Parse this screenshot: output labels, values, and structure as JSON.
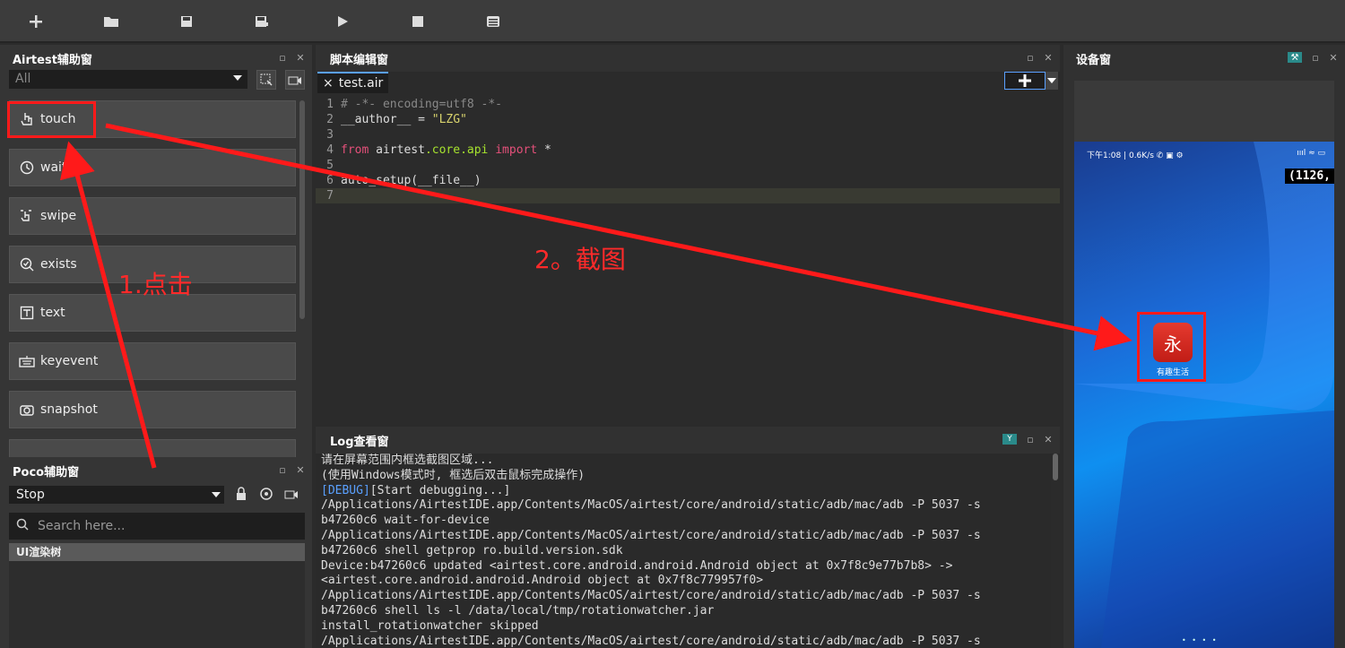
{
  "toolbar": {
    "buttons": [
      "new-icon",
      "open-folder-icon",
      "save-icon",
      "save-as-icon",
      "run-icon",
      "stop-icon",
      "log-icon"
    ]
  },
  "left_panel": {
    "title": "Airtest辅助窗",
    "filter_value": "All",
    "items": [
      {
        "label": "touch",
        "icon": "touch-icon"
      },
      {
        "label": "wait",
        "icon": "clock-icon"
      },
      {
        "label": "swipe",
        "icon": "swipe-icon"
      },
      {
        "label": "exists",
        "icon": "check-icon"
      },
      {
        "label": "text",
        "icon": "text-icon"
      },
      {
        "label": "keyevent",
        "icon": "keyboard-icon"
      },
      {
        "label": "snapshot",
        "icon": "camera-icon"
      }
    ]
  },
  "poco_panel": {
    "title": "Poco辅助窗",
    "mode_value": "Stop",
    "search_placeholder": "Search here...",
    "tree_title": "UI渲染树"
  },
  "editor": {
    "title": "脚本编辑窗",
    "tab_label": "test.air",
    "lines": [
      {
        "n": "1",
        "text": "# -*- encoding=utf8 -*-"
      },
      {
        "n": "2",
        "a": "__author__ = ",
        "b": "\"LZG\""
      },
      {
        "n": "3",
        "text": ""
      },
      {
        "n": "4",
        "a": "from",
        "b": " airtest",
        "c": ".core.api ",
        "d": "import",
        "e": " *"
      },
      {
        "n": "5",
        "text": ""
      },
      {
        "n": "6",
        "text": "auto_setup(__file__)"
      },
      {
        "n": "7",
        "text": ""
      }
    ]
  },
  "log": {
    "title": "Log查看窗",
    "lines": [
      "请在屏幕范围内框选截图区域...",
      "(使用Windows模式时, 框选后双击鼠标完成操作)",
      "[DEBUG][Start debugging...]",
      "/Applications/AirtestIDE.app/Contents/MacOS/airtest/core/android/static/adb/mac/adb -P 5037 -s",
      "b47260c6 wait-for-device",
      "/Applications/AirtestIDE.app/Contents/MacOS/airtest/core/android/static/adb/mac/adb -P 5037 -s",
      "b47260c6 shell getprop ro.build.version.sdk",
      "Device:b47260c6 updated <airtest.core.android.android.Android object at 0x7f8c9e77b7b8> ->",
      "<airtest.core.android.android.Android object at 0x7f8c779957f0>",
      "/Applications/AirtestIDE.app/Contents/MacOS/airtest/core/android/static/adb/mac/adb -P 5037 -s",
      "b47260c6 shell ls -l /data/local/tmp/rotationwatcher.jar",
      "install_rotationwatcher skipped",
      "/Applications/AirtestIDE.app/Contents/MacOS/airtest/core/android/static/adb/mac/adb -P 5037 -s"
    ]
  },
  "device": {
    "title": "设备窗",
    "status_left": "下午1:08 | 0.6K/s ✆ ▣ ⚙",
    "status_right": "ıııl ≈ ▭",
    "coord_text": "(1126,",
    "app_label": "有趣生活",
    "app_glyph": "永"
  },
  "annotations": {
    "step1": "1.点击",
    "step2": "2。截图"
  },
  "colors": {
    "annotation": "#ff1a1a",
    "accent": "#5aa0ff"
  }
}
